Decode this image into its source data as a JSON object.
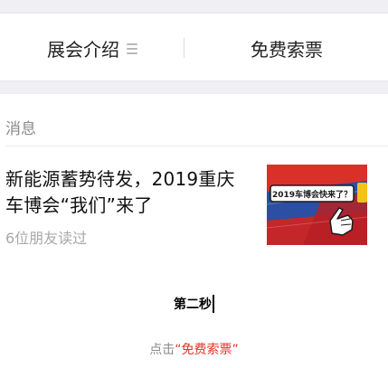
{
  "tabs": [
    {
      "label": "展会介绍",
      "has_menu_icon": true
    },
    {
      "label": "免费索票"
    }
  ],
  "section": {
    "title": "消息"
  },
  "article": {
    "title": "新能源蓄势待发，2019重庆车博会“我们”来了",
    "meta": "6位朋友读过",
    "thumbnail_text": "2019车博会快来了？"
  },
  "caption": "第二秒",
  "hint": {
    "prefix": "点击",
    "link": "“免费索票”"
  },
  "colors": {
    "accent": "#e0352b",
    "gap": "#efeff4"
  }
}
